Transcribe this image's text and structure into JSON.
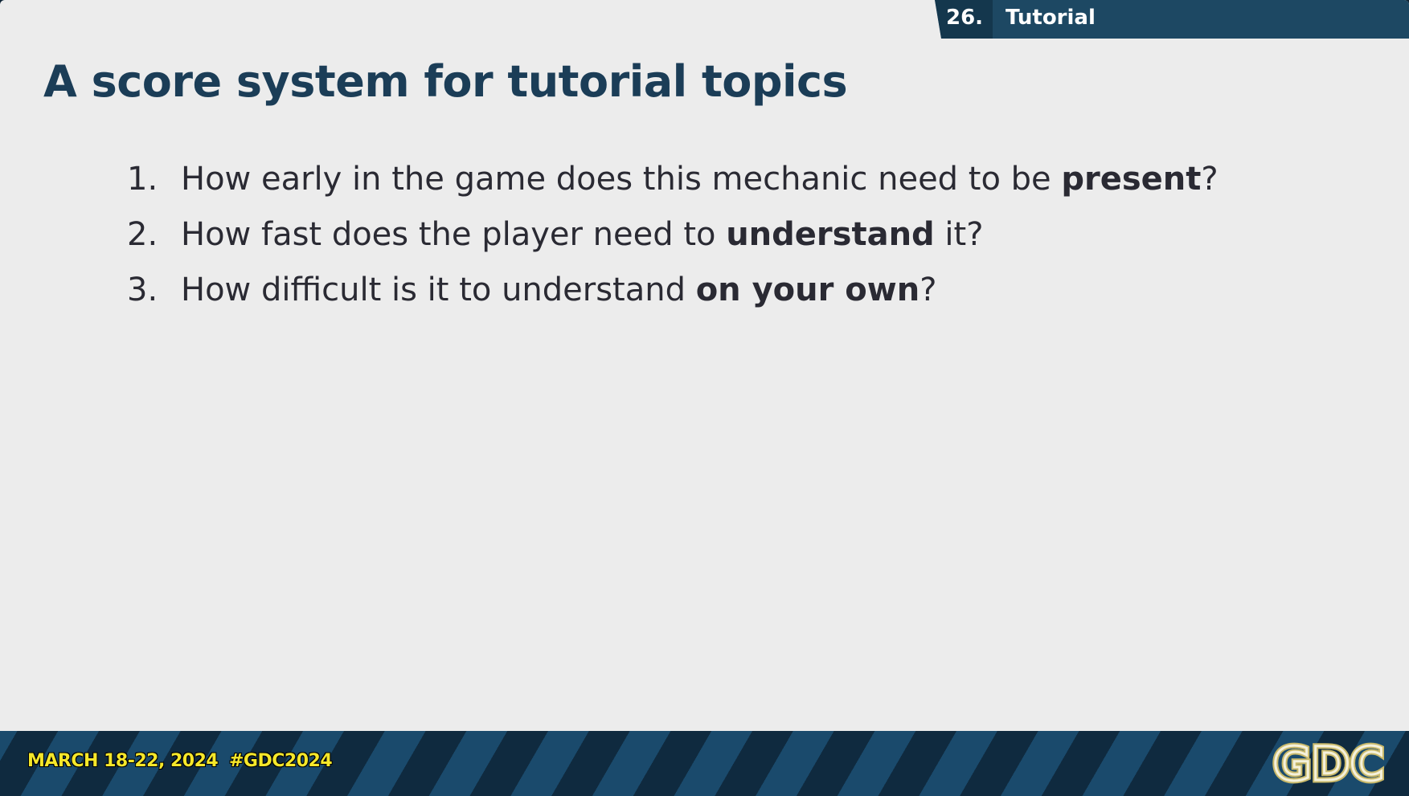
{
  "header": {
    "section_number": "26.",
    "section_label": "Tutorial"
  },
  "slide": {
    "title": "A score system for tutorial topics",
    "questions": [
      {
        "number": "1.",
        "text_before": "How early in the game does this mechanic need to be ",
        "emphasis": "present",
        "text_after": "?"
      },
      {
        "number": "2.",
        "text_before": "How fast does the player need to ",
        "emphasis": "understand",
        "text_after": " it?"
      },
      {
        "number": "3.",
        "text_before": "How difficult is it to understand ",
        "emphasis": "on your own",
        "text_after": "?"
      }
    ]
  },
  "footer": {
    "date": "MARCH 18-22, 2024",
    "hashtag": "#GDC2024",
    "logo_text": "GDC"
  },
  "colors": {
    "slide_background": "#ececec",
    "title": "#1b3d57",
    "tab": "#1d4863",
    "footer_accent": "#f5e72a"
  }
}
